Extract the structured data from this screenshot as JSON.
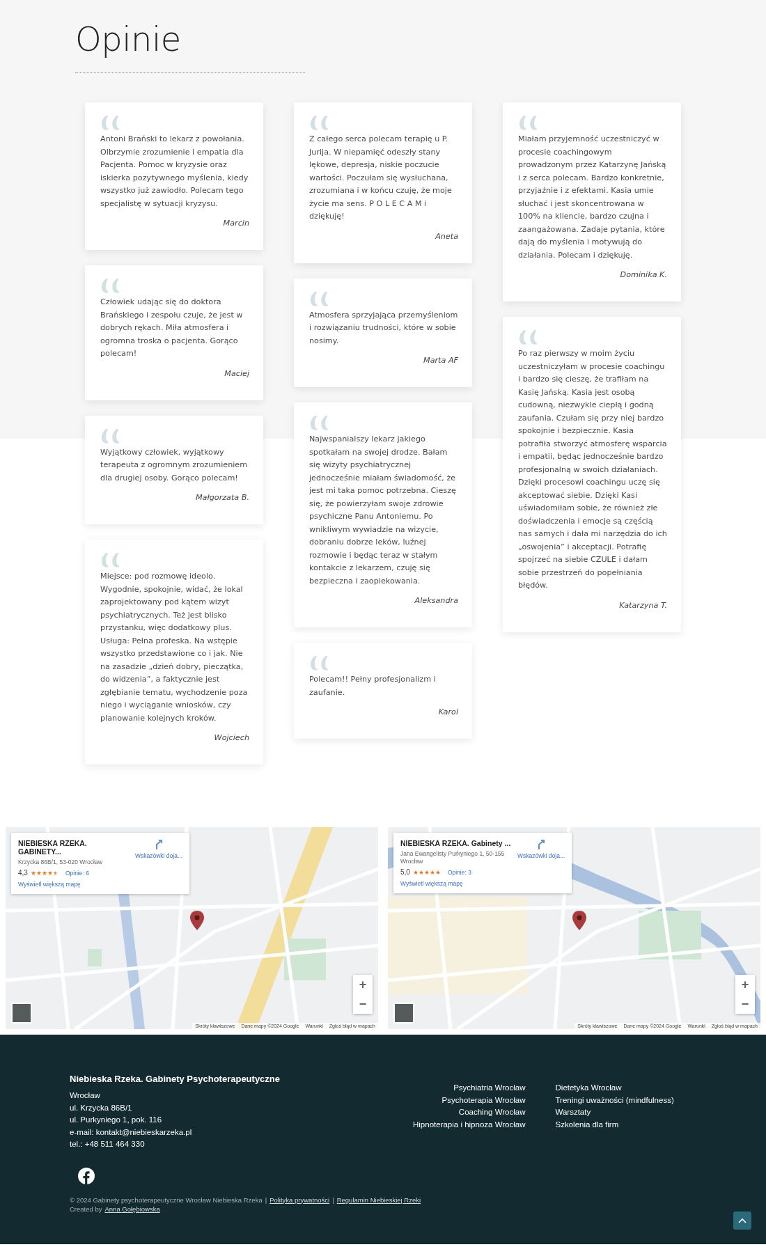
{
  "title": "Opinie",
  "testimonials": [
    [
      {
        "text": "Antoni Brański to lekarz z powołania. Olbrzymie zrozumienie i empatia dla Pacjenta. Pomoc w kryzysie oraz iskierka pozytywnego myślenia, kiedy wszystko już zawiodło. Polecam tego specjalistę w sytuacji kryzysu.",
        "author": "Marcin"
      },
      {
        "text": "Człowiek udając się do doktora Brańskiego i zespołu czuje, że jest w dobrych rękach. Miła atmosfera i ogromna troska o pacjenta. Gorąco polecam!",
        "author": "Maciej"
      },
      {
        "text": "Wyjątkowy człowiek, wyjątkowy terapeuta z ogromnym zrozumieniem dla drugiej osoby. Gorąco polecam!",
        "author": "Małgorzata B."
      },
      {
        "text": "Miejsce: pod rozmowę ideolo. Wygodnie, spokojnie, widać, że lokal zaprojektowany pod kątem wizyt psychiatrycznych. Też jest blisko przystanku, więc dodatkowy plus. Usługa: Pełna profeska. Na wstępie wszystko przedstawione co i jak. Nie na zasadzie „dzień dobry, pieczątka, do widzenia”, a faktycznie jest zgłębianie tematu, wychodzenie poza niego i wyciąganie wniosków, czy planowanie kolejnych kroków.",
        "author": "Wojciech"
      }
    ],
    [
      {
        "text": "Z całego serca polecam terapię u P. Jurija. W niepamięć odeszły stany lękowe, depresja, niskie poczucie wartości. Poczułam się wysłuchana, zrozumiana i w końcu czuję, że moje życie ma sens. P O L E C A M i dziękuję!",
        "author": "Aneta"
      },
      {
        "text": "Atmosfera sprzyjająca przemyśleniom i rozwiązaniu trudności, które w sobie nosimy.",
        "author": "Marta AF"
      },
      {
        "text": "Najwspanialszy lekarz jakiego spotkałam na swojej drodze. Bałam się wizyty psychiatrycznej jednocześnie miałam świadomość, że jest mi taka pomoc potrzebna. Cieszę się, że powierzyłam swoje zdrowie psychiczne Panu Antoniemu. Po wnikliwym wywiadzie na wizycie, dobraniu dobrze leków, luźnej rozmowie i będąc teraz w stałym kontakcie z lekarzem, czuję się bezpieczna i zaopiekowania.",
        "author": "Aleksandra"
      },
      {
        "text": "Polecam!! Pełny profesjonalizm i zaufanie.",
        "author": "Karol"
      }
    ],
    [
      {
        "text": "Miałam przyjemność uczestniczyć w procesie coachingowym prowadzonym przez Katarzynę Jańską i z serca polecam. Bardzo konkretnie, przyjaźnie i z efektami. Kasia umie słuchać i jest skoncentrowana w 100% na kliencie, bardzo czujna i zaangażowana. Zadaje pytania, które dają do myślenia i motywują do działania. Polecam i dziękuję.",
        "author": "Dominika K."
      },
      {
        "text": "Po raz pierwszy w moim życiu uczestniczyłam w procesie coachingu i bardzo się cieszę, że trafiłam na Kasię Jańską. Kasia jest osobą cudowną, niezwykle ciepłą i godną zaufania. Czułam się przy niej bardzo spokojnie i bezpiecznie. Kasia potrafiła stworzyć atmosferę wsparcia i empatii, będąc jednocześnie bardzo profesjonalną w swoich działaniach. Dzięki procesowi coachingu uczę się akceptować siebie. Dzięki Kasi uświadomiłam sobie, że również złe doświadczenia i emocje są częścią nas samych i dała mi narzędzia do ich „oswojenia” i akceptacji. Potrafię spojrzeć na siebie CZULE i dałam sobie przestrzeń do popełniania błędów.",
        "author": "Katarzyna T."
      }
    ]
  ],
  "maps": [
    {
      "kind": "suburb",
      "name": "NIEBIESKA RZEKA. GABINETY...",
      "address": "Krzycka 86B/1, 53-020 Wrocław",
      "rating": "4,3",
      "stars": 4.5,
      "reviews": "Opinie: 6",
      "directions": "Wskazówki doja...",
      "larger_map": "Wyświetl większą mapę",
      "zoom_in": "+",
      "zoom_out": "−",
      "attributions": [
        "Skróty klawiszowe",
        "Dane mapy ©2024 Google",
        "Warunki",
        "Zgłoś błąd w mapach"
      ]
    },
    {
      "kind": "city",
      "name": "NIEBIESKA RZEKA. Gabinety ...",
      "address": "Jana Ewangelisty Purkyniego 1, 50-155 Wrocław",
      "rating": "5,0",
      "stars": 5,
      "reviews": "Opinie: 3",
      "directions": "Wskazówki doja...",
      "larger_map": "Wyświetl większą mapę",
      "zoom_in": "+",
      "zoom_out": "−",
      "attributions": [
        "Skróty klawiszowe",
        "Dane mapy ©2024 Google",
        "Warunki",
        "Zgłoś błąd w mapach"
      ]
    }
  ],
  "footer": {
    "company": "Niebieska Rzeka. Gabinety Psychoterapeutyczne",
    "contact": [
      "Wrocław",
      "ul. Krzycka 86B/1",
      "ul. Purkyniego 1, pok. 116",
      "e-mail: kontakt@niebieskarzeka.pl",
      "tel.: +48 511 464 330"
    ],
    "links_left": [
      "Psychiatria Wrocław",
      "Psychoterapia Wrocław",
      "Coaching Wrocław",
      "Hipnoterapia i hipnoza Wrocław"
    ],
    "links_right": [
      "Dietetyka Wrocław",
      "Treningi uważności (mindfulness)",
      "Warsztaty",
      "Szkolenia dla firm"
    ],
    "copyright": "© 2024 Gabinety psychoterapeutyczne Wrocław Niebieska Rzeka",
    "separator": "|",
    "privacy": "Polityka prywatności",
    "terms": "Regulamin Niebieskiej Rzeki",
    "created_by": "Created by",
    "author": "Anna Gołębiowska"
  }
}
